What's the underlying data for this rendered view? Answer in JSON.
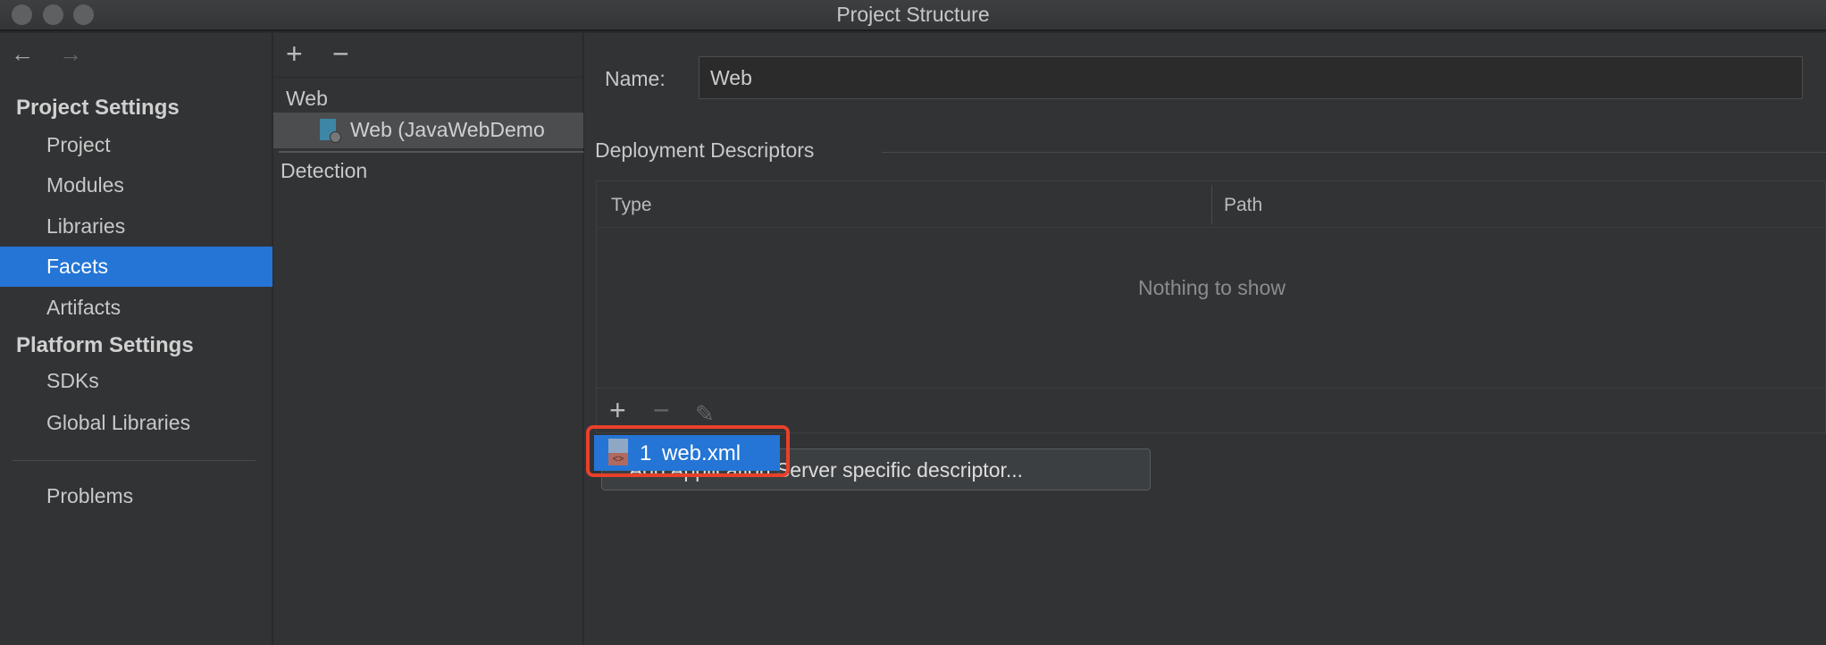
{
  "window": {
    "title": "Project Structure"
  },
  "sidebar": {
    "back_icon": "arrow-left",
    "forward_icon": "arrow-right",
    "sections": [
      {
        "header": "Project Settings",
        "items": [
          "Project",
          "Modules",
          "Libraries",
          "Facets",
          "Artifacts"
        ]
      },
      {
        "header": "Platform Settings",
        "items": [
          "SDKs",
          "Global Libraries"
        ]
      }
    ],
    "problems": "Problems",
    "selected": "Facets"
  },
  "middle": {
    "add": "+",
    "remove": "−",
    "tree": {
      "group": "Web",
      "child": "Web (JavaWebDemo",
      "detection": "Detection"
    }
  },
  "main": {
    "name_label": "Name:",
    "name_value": "Web",
    "section_title": "Deployment Descriptors",
    "table": {
      "columns": [
        "Type",
        "Path"
      ],
      "empty": "Nothing to show"
    },
    "toolbar": {
      "add": "+",
      "remove": "−",
      "edit_icon": "pencil"
    },
    "popup_item": {
      "index": "1",
      "label": "web.xml"
    },
    "add_server_button": "Add Application Server specific descriptor...",
    "accent": "#2475d6",
    "highlight": "#e8402b"
  }
}
